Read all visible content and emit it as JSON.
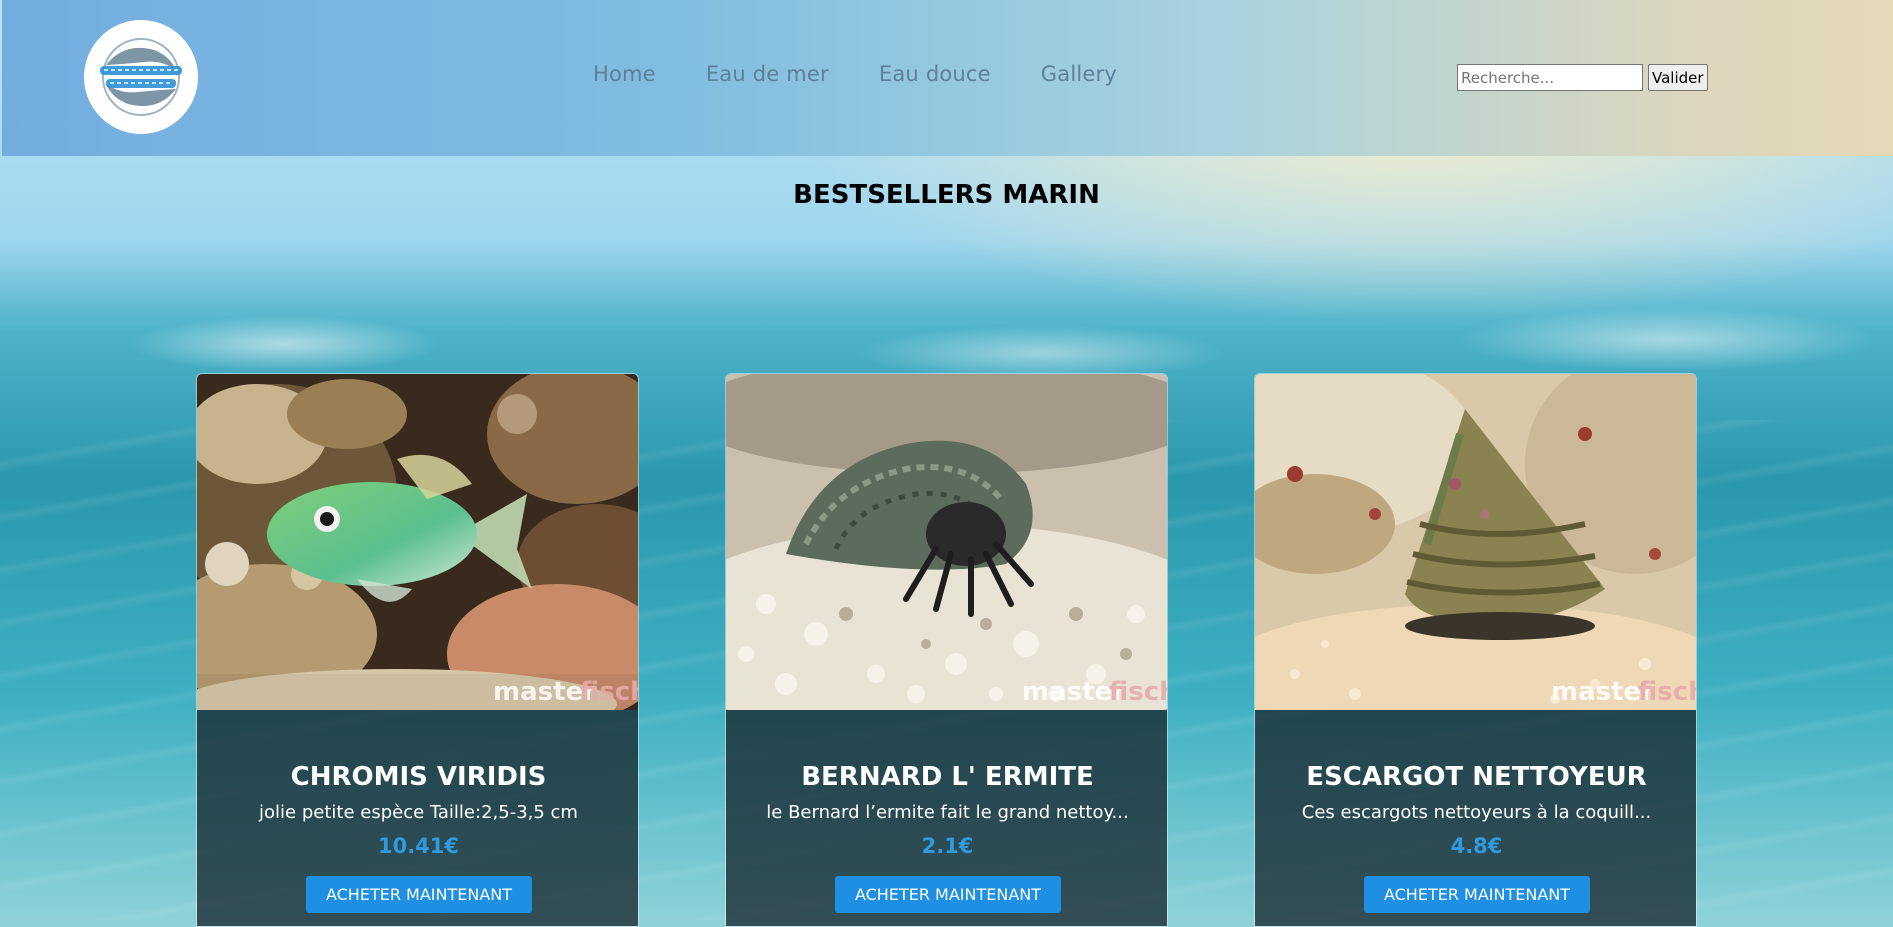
{
  "logo": {
    "alt": "logo",
    "icon": "fish-logo-icon"
  },
  "nav": [
    {
      "label": "Home"
    },
    {
      "label": "Eau de mer"
    },
    {
      "label": "Eau douce"
    },
    {
      "label": "Gallery"
    }
  ],
  "search": {
    "placeholder": "Recherche...",
    "value": "",
    "button_label": "Valider"
  },
  "section_title": "BESTSELLERS MARIN",
  "products": [
    {
      "name": "CHROMIS VIRIDIS",
      "description": "jolie petite espèce Taille:2,5-3,5 cm",
      "price": "10.41€",
      "button_label": "ACHETER MAINTENANT",
      "watermark": {
        "part1": "master",
        "part2": "fisch"
      }
    },
    {
      "name": "BERNARD L' ERMITE",
      "description": "le Bernard l’ermite fait le grand nettoy...",
      "price": "2.1€",
      "button_label": "ACHETER MAINTENANT",
      "watermark": {
        "part1": "master",
        "part2": "fisch"
      }
    },
    {
      "name": "ESCARGOT NETTOYEUR",
      "description": "Ces escargots nettoyeurs à la coquill...",
      "price": "4.8€",
      "button_label": "ACHETER MAINTENANT",
      "watermark": {
        "part1": "master",
        "part2": "fisch"
      }
    }
  ],
  "colors": {
    "accent": "#1e8fe2",
    "price": "#2e9be0",
    "nav_text": "#5f7f9b"
  }
}
